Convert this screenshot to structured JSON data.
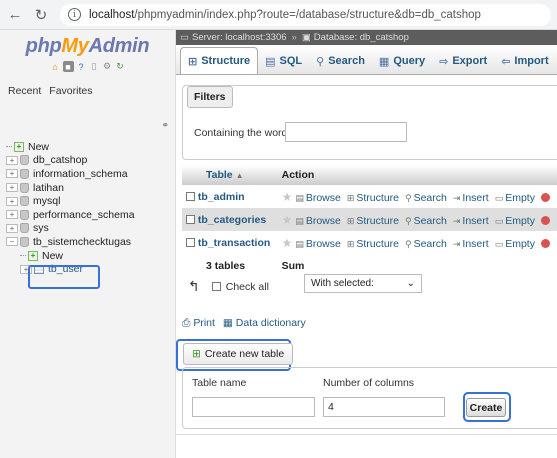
{
  "browser": {
    "url_host": "localhost",
    "url_path": "/phpmyadmin/index.php?route=/database/structure&db=db_catshop"
  },
  "logo": {
    "php": "php",
    "my": "My",
    "admin": "Admin"
  },
  "sidebar": {
    "recent": "Recent",
    "favorites": "Favorites",
    "collapse": "⚭",
    "tree": [
      {
        "label": "New",
        "type": "new",
        "expander": ""
      },
      {
        "label": "db_catshop",
        "type": "db",
        "expander": "+"
      },
      {
        "label": "information_schema",
        "type": "db",
        "expander": "+"
      },
      {
        "label": "latihan",
        "type": "db",
        "expander": "+"
      },
      {
        "label": "mysql",
        "type": "db",
        "expander": "+"
      },
      {
        "label": "performance_schema",
        "type": "db",
        "expander": "+"
      },
      {
        "label": "sys",
        "type": "db",
        "expander": "+"
      },
      {
        "label": "tb_sistemchecktugas",
        "type": "db",
        "expander": "−"
      },
      {
        "label": "New",
        "type": "new-child",
        "expander": ""
      },
      {
        "label": "tb_user",
        "type": "table-child",
        "expander": "+"
      }
    ]
  },
  "breadcrumb": {
    "server": "Server: localhost:3306",
    "sep": "»",
    "database": "Database: db_catshop"
  },
  "tabs": [
    {
      "label": "Structure",
      "icon": "⊞",
      "active": true
    },
    {
      "label": "SQL",
      "icon": "▤",
      "active": false
    },
    {
      "label": "Search",
      "icon": "⚲",
      "active": false
    },
    {
      "label": "Query",
      "icon": "▦",
      "active": false
    },
    {
      "label": "Export",
      "icon": "⇨",
      "active": false
    },
    {
      "label": "Import",
      "icon": "⇦",
      "active": false
    }
  ],
  "filters": {
    "legend": "Filters",
    "label": "Containing the word:",
    "value": ""
  },
  "table": {
    "col_table": "Table",
    "sort_indicator": "▲",
    "col_action": "Action",
    "actions": [
      "Browse",
      "Structure",
      "Search",
      "Insert",
      "Empty"
    ],
    "rows": [
      {
        "name": "tb_admin"
      },
      {
        "name": "tb_categories"
      },
      {
        "name": "tb_transaction"
      }
    ],
    "summary_count": "3 tables",
    "summary_label": "Sum"
  },
  "bulk": {
    "check_all": "Check all",
    "with_selected": "With selected:"
  },
  "links": {
    "print": "Print",
    "data_dictionary": "Data dictionary"
  },
  "create_table": {
    "legend": "Create new table",
    "table_name_label": "Table name",
    "table_name_value": "",
    "num_columns_label": "Number of columns",
    "num_columns_value": "4",
    "create_button": "Create"
  }
}
